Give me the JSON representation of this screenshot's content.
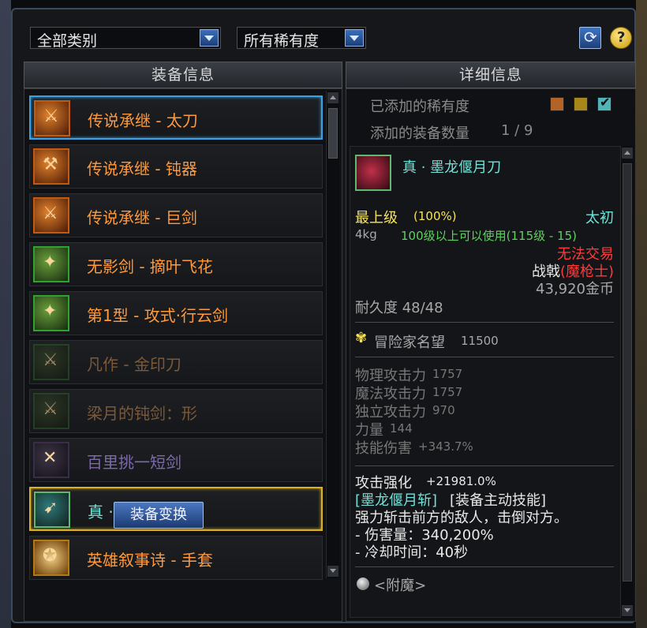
{
  "filters": {
    "category": "全部类别",
    "rarity": "所有稀有度"
  },
  "left_panel": {
    "title": "装备信息",
    "items": [
      {
        "name": "传说承继 - 太刀",
        "color": "#ff9a3c",
        "icon": "katana-icon"
      },
      {
        "name": "传说承继 - 钝器",
        "color": "#ff9a3c",
        "icon": "blunt-icon"
      },
      {
        "name": "传说承继 - 巨剑",
        "color": "#ff9a3c",
        "icon": "greatsword-icon"
      },
      {
        "name": "无影剑 - 摘叶飞花",
        "color": "#ff9a3c",
        "icon": "sword-icon"
      },
      {
        "name": "第1型 - 攻式·行云剑",
        "color": "#ff9a3c",
        "icon": "sword-icon"
      },
      {
        "name": "凡作 - 金印刀",
        "color": "#7a5a3a",
        "icon": "blade-icon"
      },
      {
        "name": "梁月的钝剑：形",
        "color": "#7a5a3a",
        "icon": "blade-icon"
      },
      {
        "name": "百里挑一短剑",
        "color": "#7d6aa8",
        "icon": "shortsword-icon"
      },
      {
        "name": "真 · 墨龙偃月刀",
        "color": "#6fe3d8",
        "icon": "glaive-icon"
      },
      {
        "name": "英雄叙事诗 - 手套",
        "color": "#ff9a3c",
        "icon": "glove-icon"
      }
    ],
    "convert_button": "装备变换"
  },
  "right_panel": {
    "title": "详细信息",
    "added_rarity_label": "已添加的稀有度",
    "rarity_colors": [
      "#b0642a",
      "#a8861a",
      "#4fb5b8"
    ],
    "added_count_label": "添加的装备数量",
    "added_count": "1 / 9",
    "detail": {
      "item_name": "真 · 墨龙偃月刀",
      "grade": "最上级",
      "grade_pct": "(100%)",
      "rarity": "太初",
      "weight": "4kg",
      "level_req": "100级以上可以使用(115级 - 15)",
      "trade": "无法交易",
      "type_prefix": "战戟",
      "type_class": "(魔枪士)",
      "price": "43,920金币",
      "durability": "耐久度 48/48",
      "fame_label": "冒险家名望",
      "fame_value": "11500",
      "stats": [
        {
          "label": "物理攻击力",
          "value": "1757"
        },
        {
          "label": "魔法攻击力",
          "value": "1757"
        },
        {
          "label": "独立攻击力",
          "value": "970"
        },
        {
          "label": "力量",
          "value": "144"
        },
        {
          "label": "技能伤害",
          "value": "+343.7%"
        }
      ],
      "attack_boost_label": "攻击强化",
      "attack_boost_value": "+21981.0%",
      "skill_name": "[墨龙偃月斩]",
      "skill_tag": "[装备主动技能]",
      "skill_desc": "强力斩击前方的敌人，击倒对方。",
      "skill_damage": "- 伤害量：340,200%",
      "skill_cooldown": "- 冷却时间：40秒",
      "enchant": "<附魔>"
    }
  }
}
